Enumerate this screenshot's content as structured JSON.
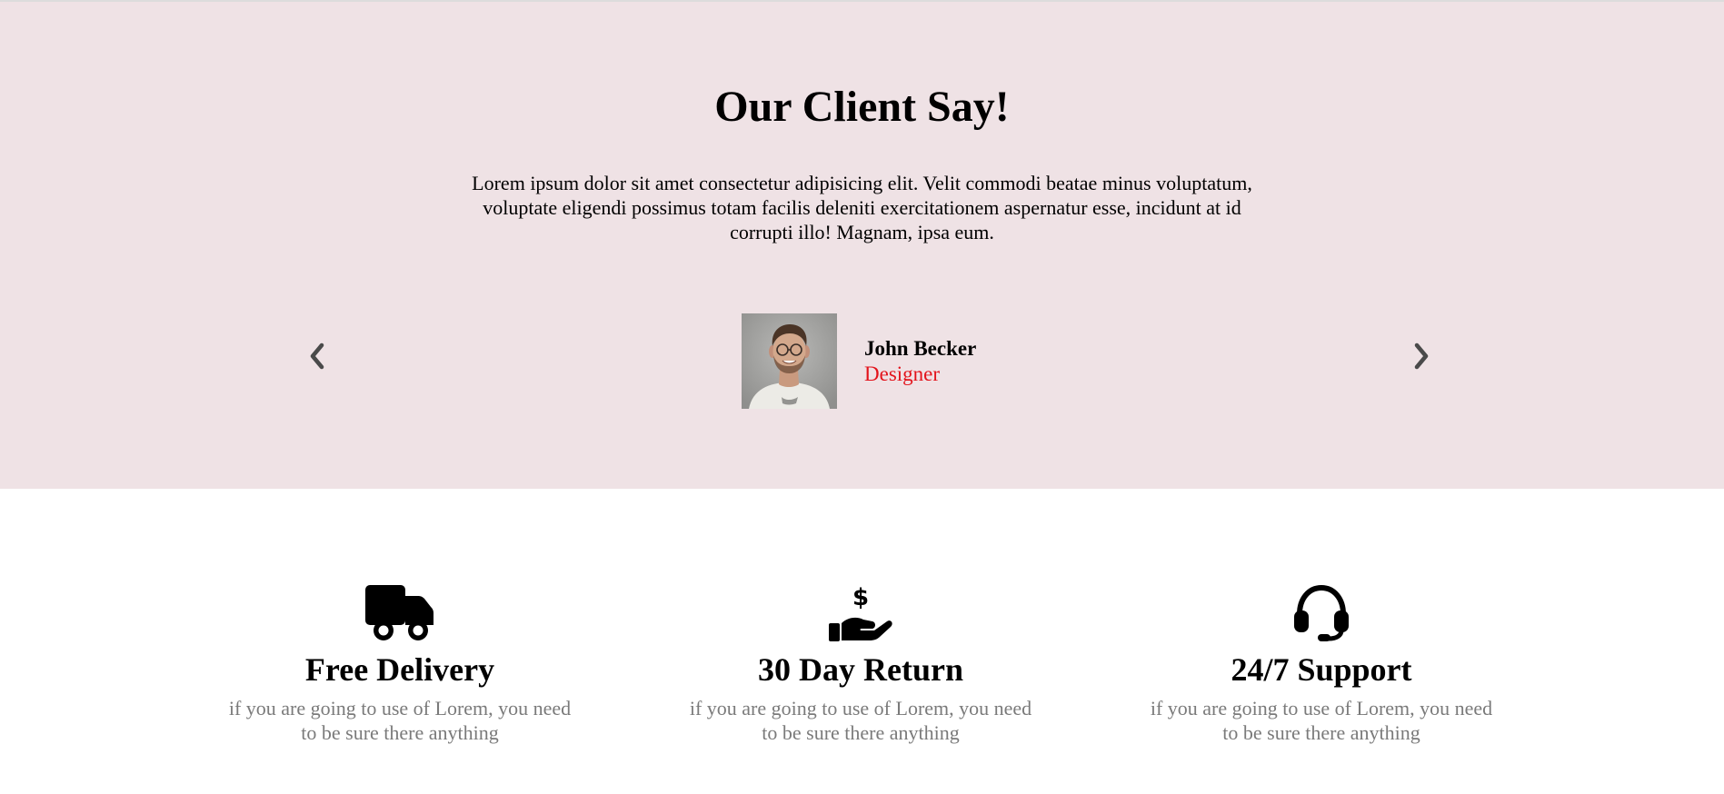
{
  "testimonial": {
    "title": "Our Client Say!",
    "description": "Lorem ipsum dolor sit amet consectetur adipisicing elit. Velit commodi beatae minus voluptatum, voluptate eligendi possimus totam facilis deleniti exercitationem aspernatur esse, incidunt at id corrupti illo! Magnam, ipsa eum.",
    "prev_icon": "chevron-left-icon",
    "next_icon": "chevron-right-icon",
    "client": {
      "name": "John Becker",
      "role": "Designer"
    },
    "colors": {
      "background": "#efe2e5",
      "role": "#e3131b"
    }
  },
  "features": [
    {
      "icon": "truck-icon",
      "title": "Free Delivery",
      "text": "if you are going to use of Lorem, you need to be sure there anything"
    },
    {
      "icon": "hand-dollar-icon",
      "title": "30 Day Return",
      "text": "if you are going to use of Lorem, you need to be sure there anything"
    },
    {
      "icon": "headset-icon",
      "title": "24/7 Support",
      "text": "if you are going to use of Lorem, you need to be sure there anything"
    }
  ],
  "colors": {
    "feature_text": "#7a7a7a",
    "arrow": "#4a4a4a"
  }
}
